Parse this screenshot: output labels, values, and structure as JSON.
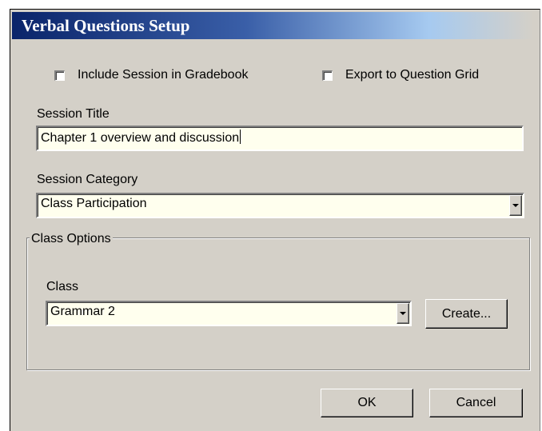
{
  "dialog": {
    "title": "Verbal Questions Setup"
  },
  "options": {
    "include_gradebook": {
      "label": "Include Session in Gradebook",
      "checked": false
    },
    "export_grid": {
      "label": "Export to Question Grid",
      "checked": false
    }
  },
  "session_title": {
    "label": "Session Title",
    "value": "Chapter 1 overview and discussion"
  },
  "session_category": {
    "label": "Session Category",
    "value": "Class Participation"
  },
  "class_options": {
    "legend": "Class Options",
    "class_label": "Class",
    "class_value": "Grammar 2",
    "create_label": "Create..."
  },
  "buttons": {
    "ok": "OK",
    "cancel": "Cancel"
  }
}
